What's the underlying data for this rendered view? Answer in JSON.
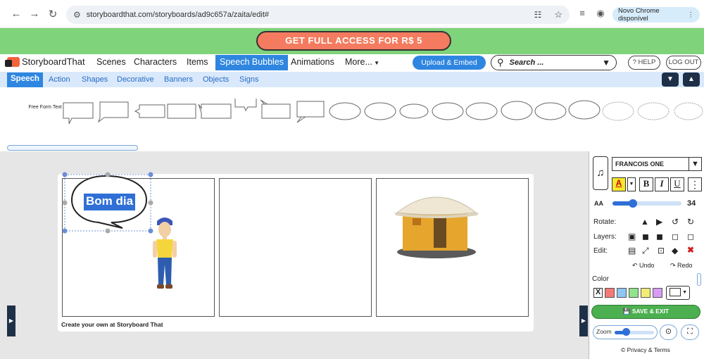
{
  "browser": {
    "url": "storyboardthat.com/storyboards/ad9c657a/zaita/edit#",
    "chrome_update": "Novo Chrome disponível"
  },
  "promo": {
    "label": "GET FULL ACCESS FOR R$ 5"
  },
  "topnav": {
    "logo": "StoryboardThat",
    "items": [
      "Scenes",
      "Characters",
      "Items",
      "Speech Bubbles",
      "Animations",
      "More..."
    ],
    "upload": "Upload & Embed",
    "search_placeholder": "Search ...",
    "help": "? HELP",
    "logout": "LOG OUT"
  },
  "subnav": {
    "items": [
      "Speech",
      "Action",
      "Shapes",
      "Decorative",
      "Banners",
      "Objects",
      "Signs"
    ]
  },
  "palette": {
    "freeform": "Free Form Text"
  },
  "canvas": {
    "bubble_text": "Bom dia",
    "footer": "Create your own at Storyboard That"
  },
  "panel": {
    "font": "FRANCOIS ONE",
    "bold": "B",
    "italic": "I",
    "underline": "U",
    "font_size_icon": "AA",
    "font_size": "34",
    "font_size_slider": 0.3,
    "rotate_label": "Rotate:",
    "layers_label": "Layers:",
    "edit_label": "Edit:",
    "undo": "Undo",
    "redo": "Redo",
    "color_label": "Color",
    "no_color": "X",
    "swatches": [
      "#f37a78",
      "#8fc6f2",
      "#8fe38b",
      "#f2ec77",
      "#d99cf2"
    ],
    "save": "SAVE & EXIT",
    "zoom_label": "Zoom",
    "zoom_slider": 0.3,
    "terms": "© Privacy & Terms"
  }
}
